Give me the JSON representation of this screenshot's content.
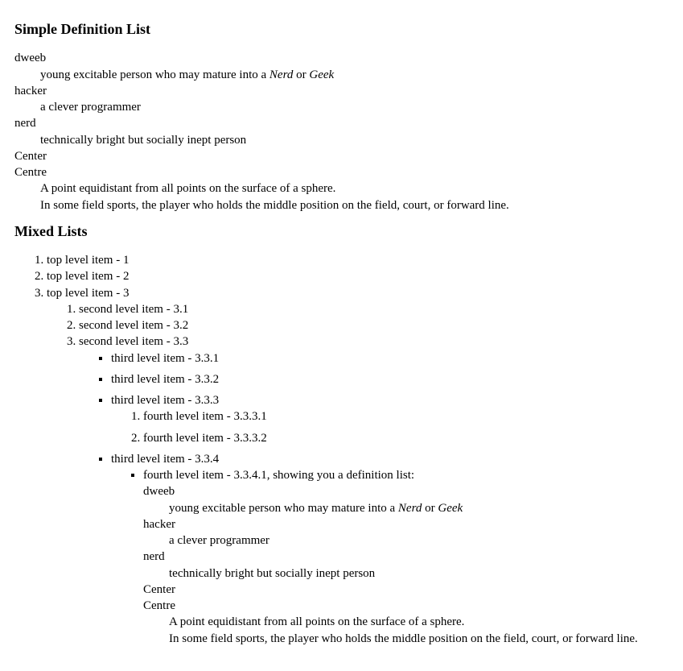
{
  "sections": {
    "defTitle": "Simple Definition List",
    "mixedTitle": "Mixed Lists"
  },
  "defs": {
    "dweeb": {
      "term": "dweeb",
      "pre": "young excitable person who may mature into a ",
      "em1": "Nerd",
      "mid": " or ",
      "em2": "Geek"
    },
    "hacker": {
      "term": "hacker",
      "desc": "a clever programmer"
    },
    "nerd": {
      "term": "nerd",
      "desc": "technically bright but socially inept person"
    },
    "center": {
      "term1": "Center",
      "term2": "Centre",
      "desc1": "A point equidistant from all points on the surface of a sphere.",
      "desc2": "In some field sports, the player who holds the middle position on the field, court, or forward line."
    }
  },
  "mixed": {
    "l1_1": "top level item - 1",
    "l1_2": "top level item - 2",
    "l1_3": "top level item - 3",
    "l2_1": "second level item - 3.1",
    "l2_2": "second level item - 3.2",
    "l2_3": "second level item - 3.3",
    "l3_1": "third level item - 3.3.1",
    "l3_2": "third level item - 3.3.2",
    "l3_3": "third level item - 3.3.3",
    "l3_4": "third level item - 3.3.4",
    "l4_331": "fourth level item - 3.3.3.1",
    "l4_332": "fourth level item - 3.3.3.2",
    "l4_341": "fourth level item - 3.3.4.1, showing you a definition list:"
  }
}
